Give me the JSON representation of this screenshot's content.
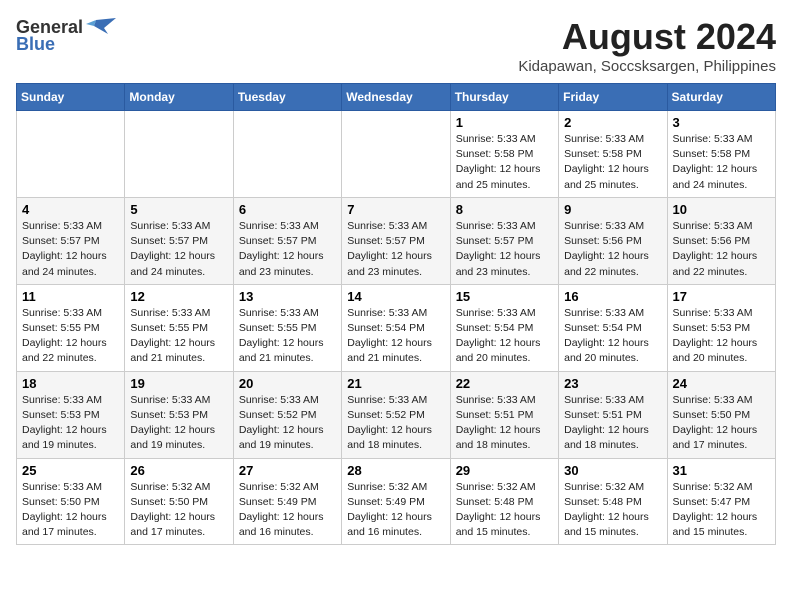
{
  "header": {
    "logo_general": "General",
    "logo_blue": "Blue",
    "month_title": "August 2024",
    "location": "Kidapawan, Soccsksargen, Philippines"
  },
  "days_of_week": [
    "Sunday",
    "Monday",
    "Tuesday",
    "Wednesday",
    "Thursday",
    "Friday",
    "Saturday"
  ],
  "weeks": [
    [
      {
        "day": "",
        "content": ""
      },
      {
        "day": "",
        "content": ""
      },
      {
        "day": "",
        "content": ""
      },
      {
        "day": "",
        "content": ""
      },
      {
        "day": "1",
        "content": "Sunrise: 5:33 AM\nSunset: 5:58 PM\nDaylight: 12 hours\nand 25 minutes."
      },
      {
        "day": "2",
        "content": "Sunrise: 5:33 AM\nSunset: 5:58 PM\nDaylight: 12 hours\nand 25 minutes."
      },
      {
        "day": "3",
        "content": "Sunrise: 5:33 AM\nSunset: 5:58 PM\nDaylight: 12 hours\nand 24 minutes."
      }
    ],
    [
      {
        "day": "4",
        "content": "Sunrise: 5:33 AM\nSunset: 5:57 PM\nDaylight: 12 hours\nand 24 minutes."
      },
      {
        "day": "5",
        "content": "Sunrise: 5:33 AM\nSunset: 5:57 PM\nDaylight: 12 hours\nand 24 minutes."
      },
      {
        "day": "6",
        "content": "Sunrise: 5:33 AM\nSunset: 5:57 PM\nDaylight: 12 hours\nand 23 minutes."
      },
      {
        "day": "7",
        "content": "Sunrise: 5:33 AM\nSunset: 5:57 PM\nDaylight: 12 hours\nand 23 minutes."
      },
      {
        "day": "8",
        "content": "Sunrise: 5:33 AM\nSunset: 5:57 PM\nDaylight: 12 hours\nand 23 minutes."
      },
      {
        "day": "9",
        "content": "Sunrise: 5:33 AM\nSunset: 5:56 PM\nDaylight: 12 hours\nand 22 minutes."
      },
      {
        "day": "10",
        "content": "Sunrise: 5:33 AM\nSunset: 5:56 PM\nDaylight: 12 hours\nand 22 minutes."
      }
    ],
    [
      {
        "day": "11",
        "content": "Sunrise: 5:33 AM\nSunset: 5:55 PM\nDaylight: 12 hours\nand 22 minutes."
      },
      {
        "day": "12",
        "content": "Sunrise: 5:33 AM\nSunset: 5:55 PM\nDaylight: 12 hours\nand 21 minutes."
      },
      {
        "day": "13",
        "content": "Sunrise: 5:33 AM\nSunset: 5:55 PM\nDaylight: 12 hours\nand 21 minutes."
      },
      {
        "day": "14",
        "content": "Sunrise: 5:33 AM\nSunset: 5:54 PM\nDaylight: 12 hours\nand 21 minutes."
      },
      {
        "day": "15",
        "content": "Sunrise: 5:33 AM\nSunset: 5:54 PM\nDaylight: 12 hours\nand 20 minutes."
      },
      {
        "day": "16",
        "content": "Sunrise: 5:33 AM\nSunset: 5:54 PM\nDaylight: 12 hours\nand 20 minutes."
      },
      {
        "day": "17",
        "content": "Sunrise: 5:33 AM\nSunset: 5:53 PM\nDaylight: 12 hours\nand 20 minutes."
      }
    ],
    [
      {
        "day": "18",
        "content": "Sunrise: 5:33 AM\nSunset: 5:53 PM\nDaylight: 12 hours\nand 19 minutes."
      },
      {
        "day": "19",
        "content": "Sunrise: 5:33 AM\nSunset: 5:53 PM\nDaylight: 12 hours\nand 19 minutes."
      },
      {
        "day": "20",
        "content": "Sunrise: 5:33 AM\nSunset: 5:52 PM\nDaylight: 12 hours\nand 19 minutes."
      },
      {
        "day": "21",
        "content": "Sunrise: 5:33 AM\nSunset: 5:52 PM\nDaylight: 12 hours\nand 18 minutes."
      },
      {
        "day": "22",
        "content": "Sunrise: 5:33 AM\nSunset: 5:51 PM\nDaylight: 12 hours\nand 18 minutes."
      },
      {
        "day": "23",
        "content": "Sunrise: 5:33 AM\nSunset: 5:51 PM\nDaylight: 12 hours\nand 18 minutes."
      },
      {
        "day": "24",
        "content": "Sunrise: 5:33 AM\nSunset: 5:50 PM\nDaylight: 12 hours\nand 17 minutes."
      }
    ],
    [
      {
        "day": "25",
        "content": "Sunrise: 5:33 AM\nSunset: 5:50 PM\nDaylight: 12 hours\nand 17 minutes."
      },
      {
        "day": "26",
        "content": "Sunrise: 5:32 AM\nSunset: 5:50 PM\nDaylight: 12 hours\nand 17 minutes."
      },
      {
        "day": "27",
        "content": "Sunrise: 5:32 AM\nSunset: 5:49 PM\nDaylight: 12 hours\nand 16 minutes."
      },
      {
        "day": "28",
        "content": "Sunrise: 5:32 AM\nSunset: 5:49 PM\nDaylight: 12 hours\nand 16 minutes."
      },
      {
        "day": "29",
        "content": "Sunrise: 5:32 AM\nSunset: 5:48 PM\nDaylight: 12 hours\nand 15 minutes."
      },
      {
        "day": "30",
        "content": "Sunrise: 5:32 AM\nSunset: 5:48 PM\nDaylight: 12 hours\nand 15 minutes."
      },
      {
        "day": "31",
        "content": "Sunrise: 5:32 AM\nSunset: 5:47 PM\nDaylight: 12 hours\nand 15 minutes."
      }
    ]
  ]
}
